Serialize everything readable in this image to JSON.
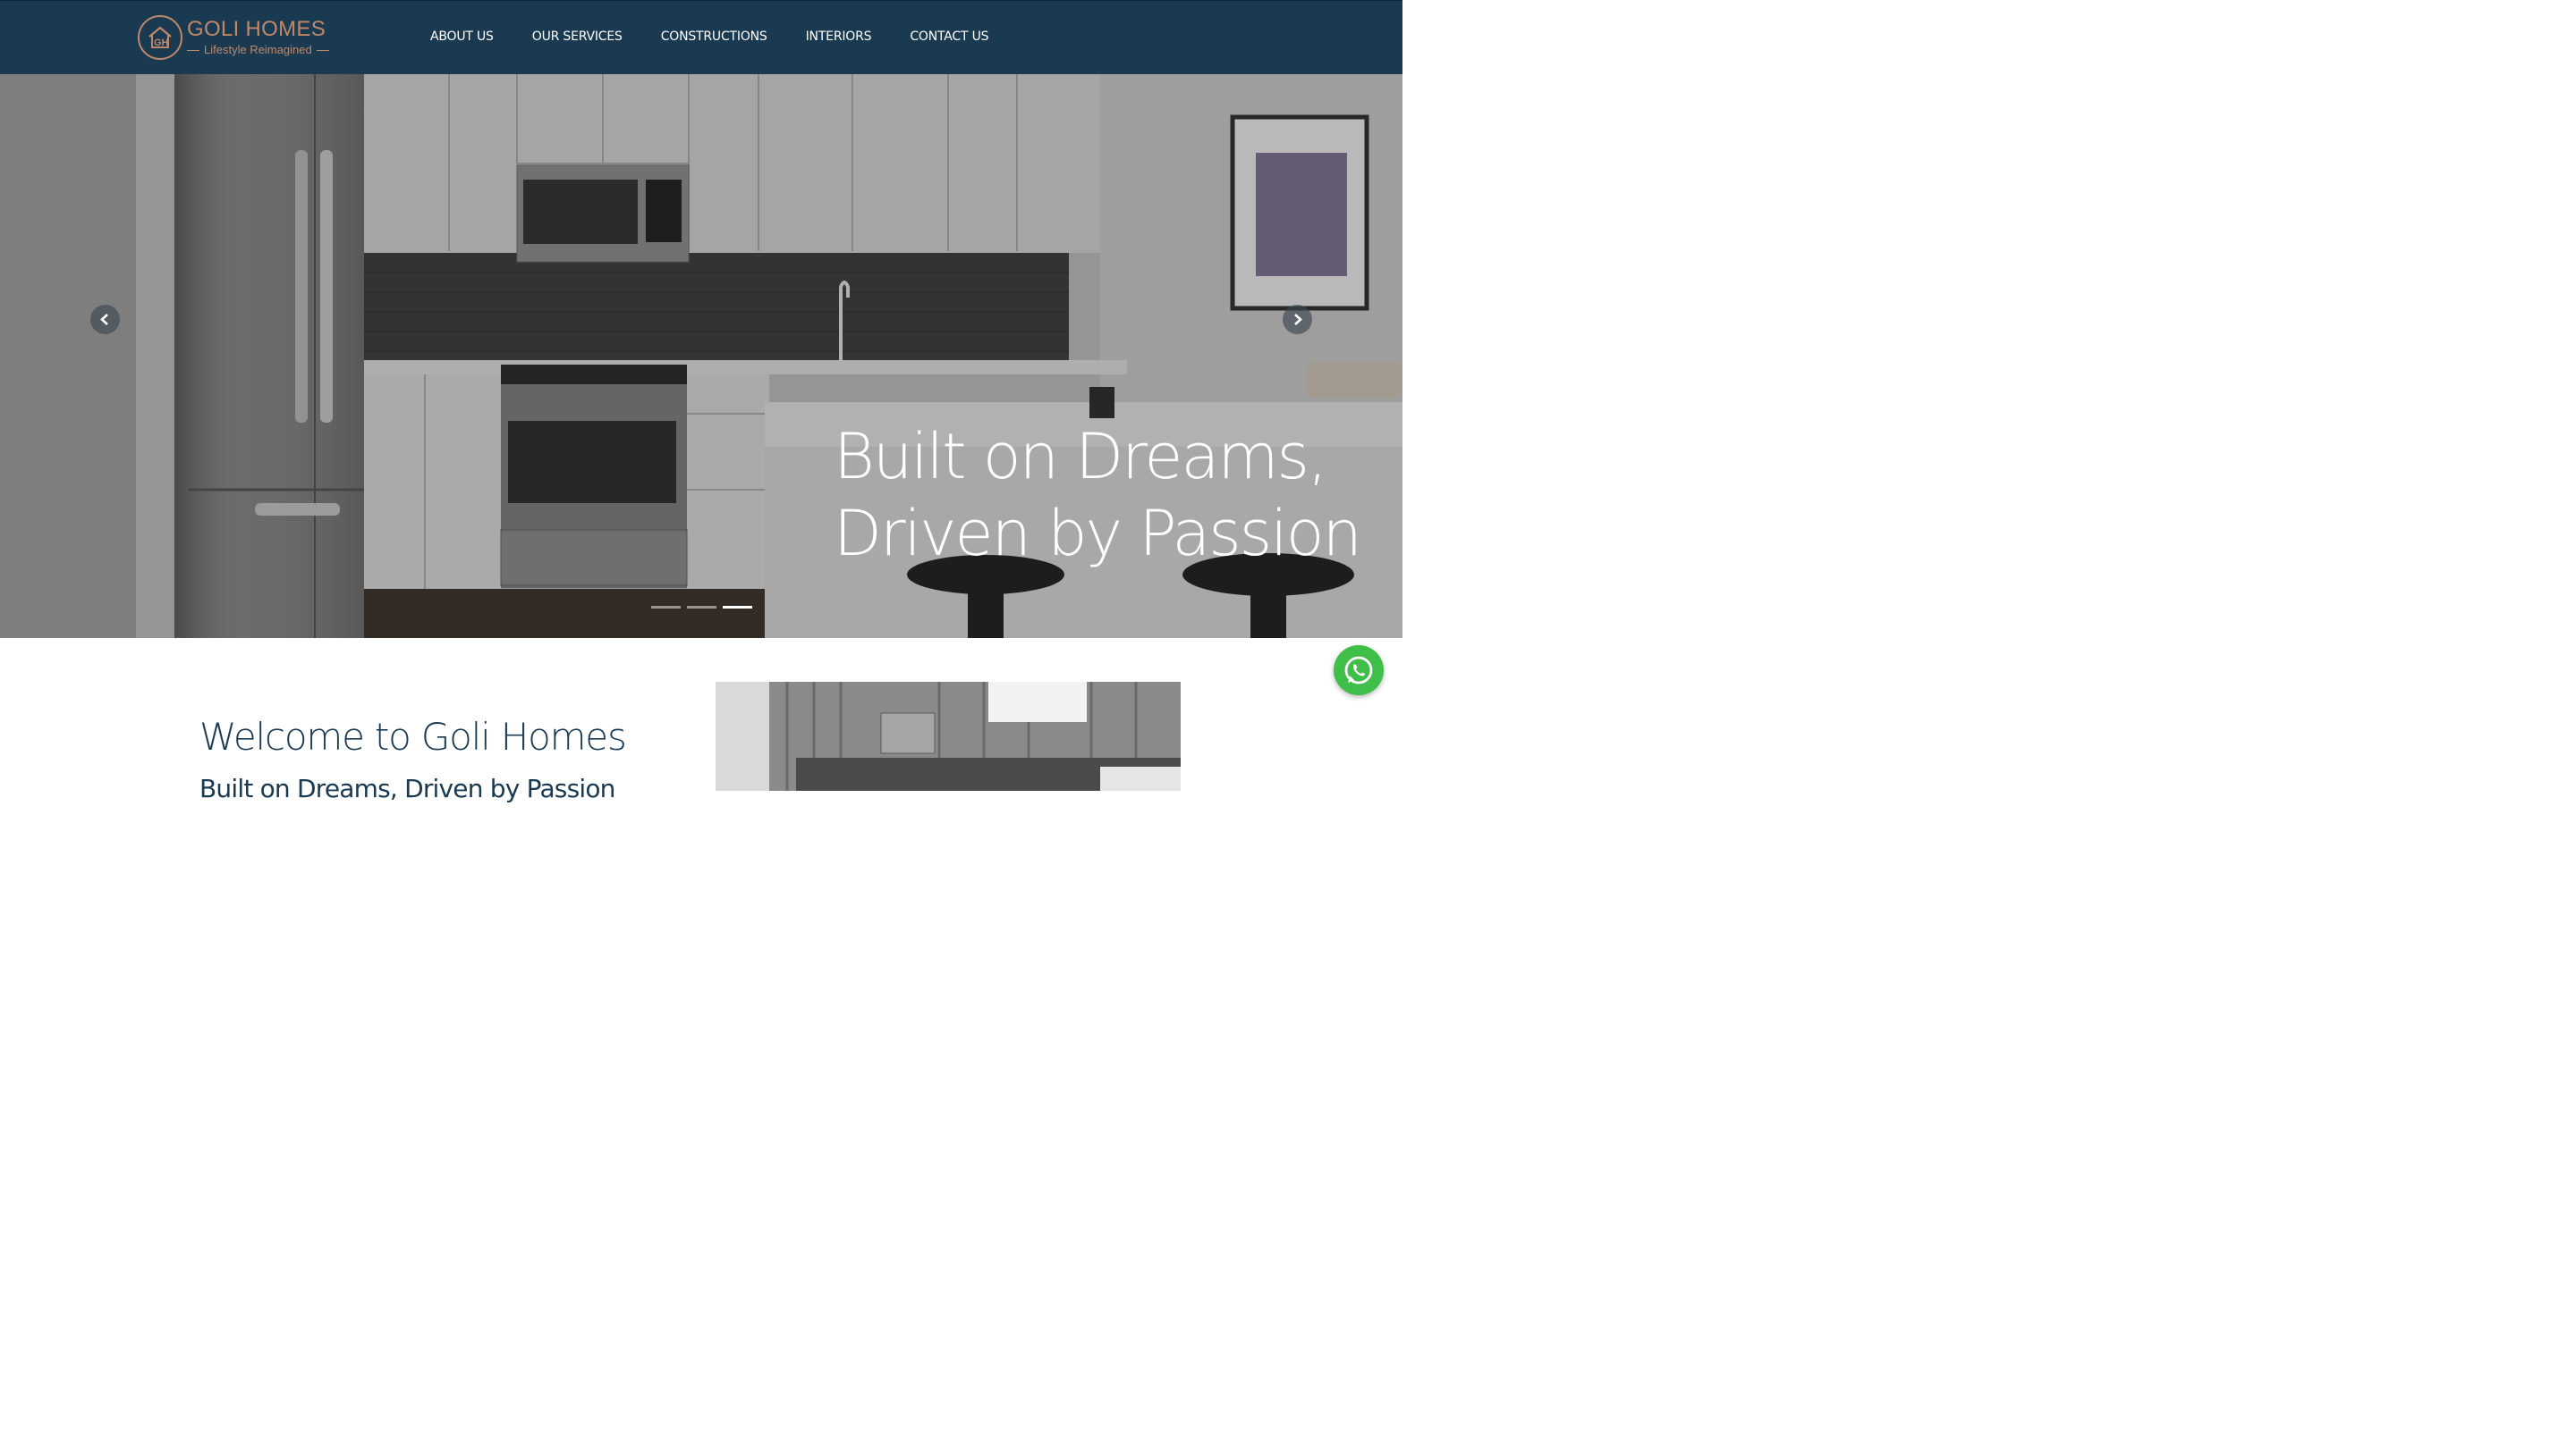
{
  "brand": {
    "name": "GOLI HOMES",
    "tagline": "Lifestyle Reimagined",
    "logo_icon": "house-monogram-icon",
    "accent_color": "#c08868",
    "header_color": "#1a3a52"
  },
  "nav": {
    "items": [
      {
        "label": "ABOUT US"
      },
      {
        "label": "OUR SERVICES"
      },
      {
        "label": "CONSTRUCTIONS"
      },
      {
        "label": "INTERIORS"
      },
      {
        "label": "CONTACT US"
      }
    ]
  },
  "hero": {
    "line1": "Built on Dreams,",
    "line2": "Driven by Passion",
    "prev_icon": "chevron-left-icon",
    "next_icon": "chevron-right-icon",
    "slides": 3,
    "active_slide": 3
  },
  "welcome": {
    "title": "Welcome to Goli Homes",
    "subtitle": "Built on Dreams, Driven by Passion"
  },
  "floating": {
    "icon": "whatsapp-icon",
    "color": "#3fbf4a"
  }
}
